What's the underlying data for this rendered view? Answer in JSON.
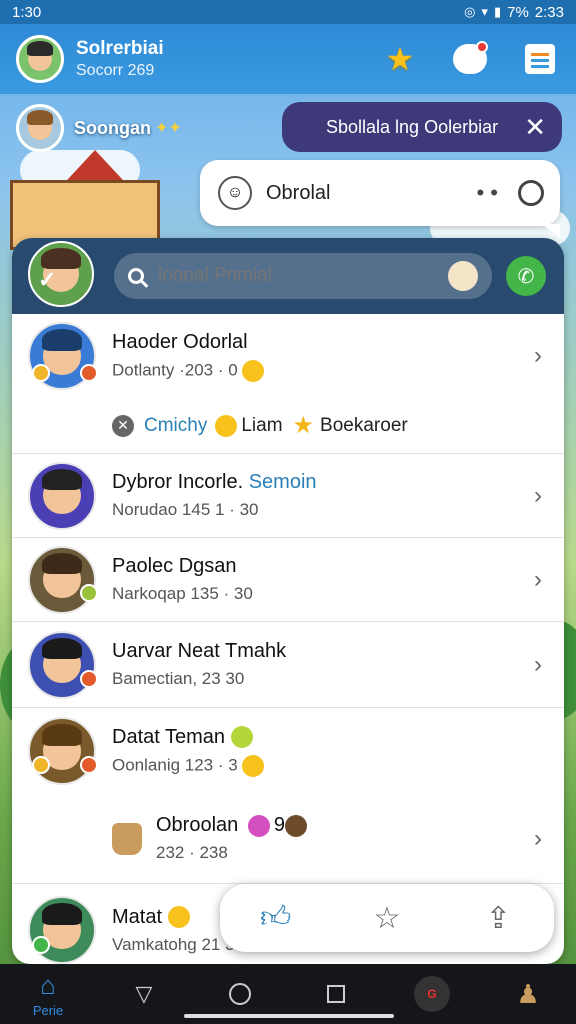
{
  "status_bar": {
    "time": "1:30",
    "battery": "7%",
    "clock": "2:33"
  },
  "header": {
    "title": "Solrerbiai",
    "subtitle": "Socorr 269"
  },
  "game_user": {
    "name": "Soongan"
  },
  "toast": {
    "text": "Sbollala lng Oolerbiar"
  },
  "chat_bubble": {
    "label": "Obrolal",
    "dots": "• •"
  },
  "search": {
    "placeholder": "loooal Pnmial",
    "value": ""
  },
  "contacts": [
    {
      "name": "Haoder Odorlal",
      "name_highlight": "",
      "sub": "Dotlanty ·203 · 0"
    },
    {
      "name": "Dybror Incorle.",
      "name_highlight": "Semoin",
      "sub": "Norudao 145 1 · 30"
    },
    {
      "name": "Paolec Dgsan",
      "name_highlight": "",
      "sub": "Narkoqap 135 ·  30"
    },
    {
      "name": "Uarvar Neat Tmahk",
      "name_highlight": "",
      "sub": "Bamectian, 23 30"
    },
    {
      "name": "Datat Teman",
      "name_highlight": "",
      "sub": "Oonlanig 123 · 3"
    },
    {
      "name": "Matat",
      "name_highlight": "",
      "sub": "Vamkatohg  21  32"
    }
  ],
  "reactions": {
    "label1": "Cmichy",
    "label2": "Liam",
    "label3": "Boekaroer"
  },
  "sub_item": {
    "title": "Obroolan",
    "suffix": "9",
    "sub": "232 · 238"
  },
  "nav": {
    "home_label": "Perie"
  },
  "colors": {
    "accent": "#2e8ad6",
    "panel_header": "#274a6e",
    "call_green": "#43b549",
    "toast_bg": "#3e3a7a"
  }
}
